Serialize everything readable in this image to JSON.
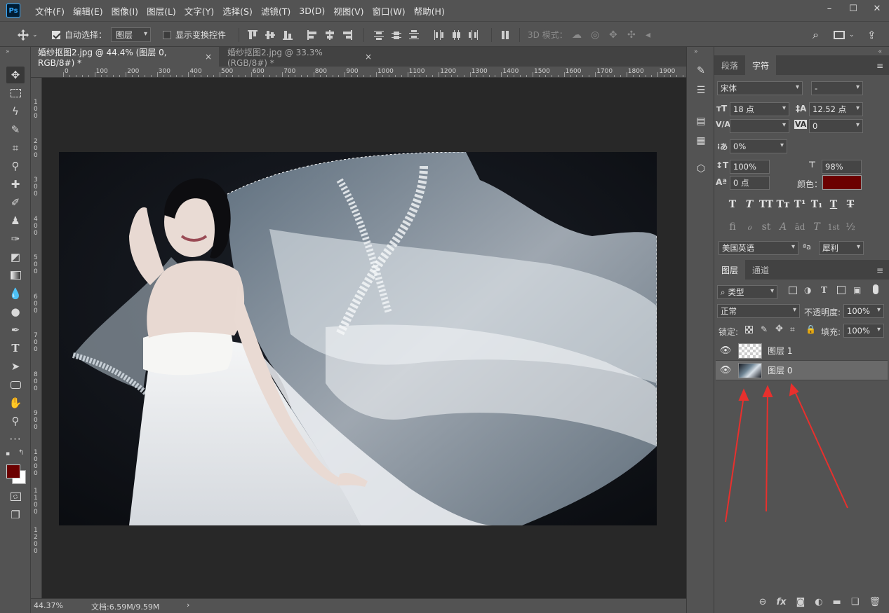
{
  "app": {
    "logo_text": "Ps",
    "menu": [
      "文件(F)",
      "编辑(E)",
      "图像(I)",
      "图层(L)",
      "文字(Y)",
      "选择(S)",
      "滤镜(T)",
      "3D(D)",
      "视图(V)",
      "窗口(W)",
      "帮助(H)"
    ],
    "window_controls": [
      "–",
      "☐",
      "✕"
    ]
  },
  "options_bar": {
    "auto_select_label": "自动选择：",
    "auto_select_checked": true,
    "auto_select_target": "图层",
    "show_transform_label": "显示变换控件",
    "show_transform_checked": false,
    "mode_3d_label": "3D 模式："
  },
  "tabs": [
    {
      "title": "婚纱抠图2.jpg @ 44.4% (图层 0, RGB/8#) *",
      "close": "×",
      "active": true
    },
    {
      "title": "婚纱抠图2.jpg @ 33.3%(RGB/8#) *",
      "close": "×",
      "active": false
    }
  ],
  "ruler_top_labels": [
    "0",
    "100",
    "200",
    "300",
    "400",
    "500",
    "600",
    "700",
    "800",
    "900",
    "1000",
    "1100",
    "1200",
    "1300",
    "1400",
    "1500",
    "1600",
    "1700",
    "1800",
    "1900"
  ],
  "ruler_left_labels": [
    "100",
    "200",
    "300",
    "400",
    "500",
    "600",
    "700",
    "800",
    "900",
    "1000",
    "1100",
    "1200"
  ],
  "status": {
    "zoom": "44.37%",
    "doc_info": "文档:6.59M/9.59M",
    "arrow": "›"
  },
  "character_panel": {
    "tabs": [
      "段落",
      "字符"
    ],
    "active_tab": "字符",
    "font_family": "宋体",
    "font_style": "-",
    "font_size": "18 点",
    "leading": "12.52 点",
    "kerning": "",
    "tracking": "0",
    "tsume": "0%",
    "vertical_scale": "100%",
    "horizontal_scale": "98%",
    "baseline_shift": "0 点",
    "color_label": "颜色：",
    "color": "#6b0000",
    "language": "美国英语",
    "aa_label": "ªa",
    "antialias": "犀利",
    "format_buttons": [
      "T",
      "T",
      "TT",
      "Tт",
      "T¹",
      "T₁",
      "T",
      "T"
    ],
    "opentype_buttons": [
      "fi",
      "ℴ",
      "st",
      "A",
      "ād",
      "T",
      "1st",
      "½"
    ]
  },
  "layers_panel": {
    "tabs": [
      "图层",
      "通道"
    ],
    "active_tab": "图层",
    "filter_label": "类型",
    "blend_mode": "正常",
    "opacity_label": "不透明度:",
    "opacity": "100%",
    "lock_label": "锁定:",
    "fill_label": "填充:",
    "fill": "100%",
    "layers": [
      {
        "name": "图层 1",
        "visible": true,
        "selected": false,
        "thumb": "transparent"
      },
      {
        "name": "图层 0",
        "visible": true,
        "selected": true,
        "thumb": "photo"
      }
    ],
    "footer_icons": [
      "link-icon",
      "fx-icon",
      "mask-icon",
      "adjustment-icon",
      "group-icon",
      "new-layer-icon",
      "trash-icon"
    ],
    "fx_label": "fx"
  },
  "colors": {
    "foreground": "#6b0000",
    "background": "#ffffff",
    "annotation_arrow": "#e8302d"
  }
}
